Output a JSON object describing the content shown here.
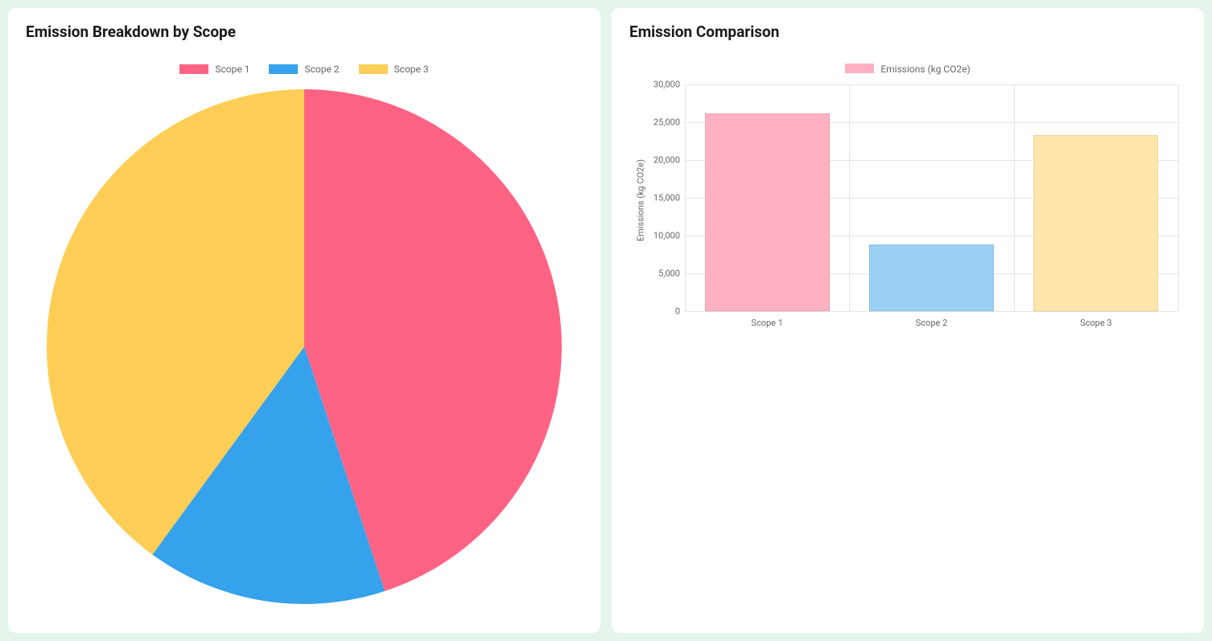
{
  "left": {
    "title": "Emission Breakdown by Scope",
    "legend": [
      "Scope 1",
      "Scope 2",
      "Scope 3"
    ]
  },
  "right": {
    "title": "Emission Comparison",
    "legend": "Emissions (kg CO2e)",
    "y_axis_title": "Emissions (kg CO2e)",
    "y_ticks": [
      "0",
      "5,000",
      "10,000",
      "15,000",
      "20,000",
      "25,000",
      "30,000"
    ],
    "x_labels": [
      "Scope 1",
      "Scope 2",
      "Scope 3"
    ]
  },
  "colors": {
    "scope1_strong": "#ff6384",
    "scope2_strong": "#36a2eb",
    "scope3_strong": "#ffce56",
    "scope1_light": "#ffb1c1",
    "scope2_light": "#9ad0f5",
    "scope3_light": "#ffe6aa"
  },
  "chart_data": [
    {
      "type": "pie",
      "title": "Emission Breakdown by Scope",
      "categories": [
        "Scope 1",
        "Scope 2",
        "Scope 3"
      ],
      "values": [
        26200,
        8800,
        23300
      ]
    },
    {
      "type": "bar",
      "title": "Emission Comparison",
      "categories": [
        "Scope 1",
        "Scope 2",
        "Scope 3"
      ],
      "values": [
        26200,
        8800,
        23300
      ],
      "series_name": "Emissions (kg CO2e)",
      "xlabel": "",
      "ylabel": "Emissions (kg CO2e)",
      "ylim": [
        0,
        30000
      ],
      "y_step": 5000
    }
  ]
}
